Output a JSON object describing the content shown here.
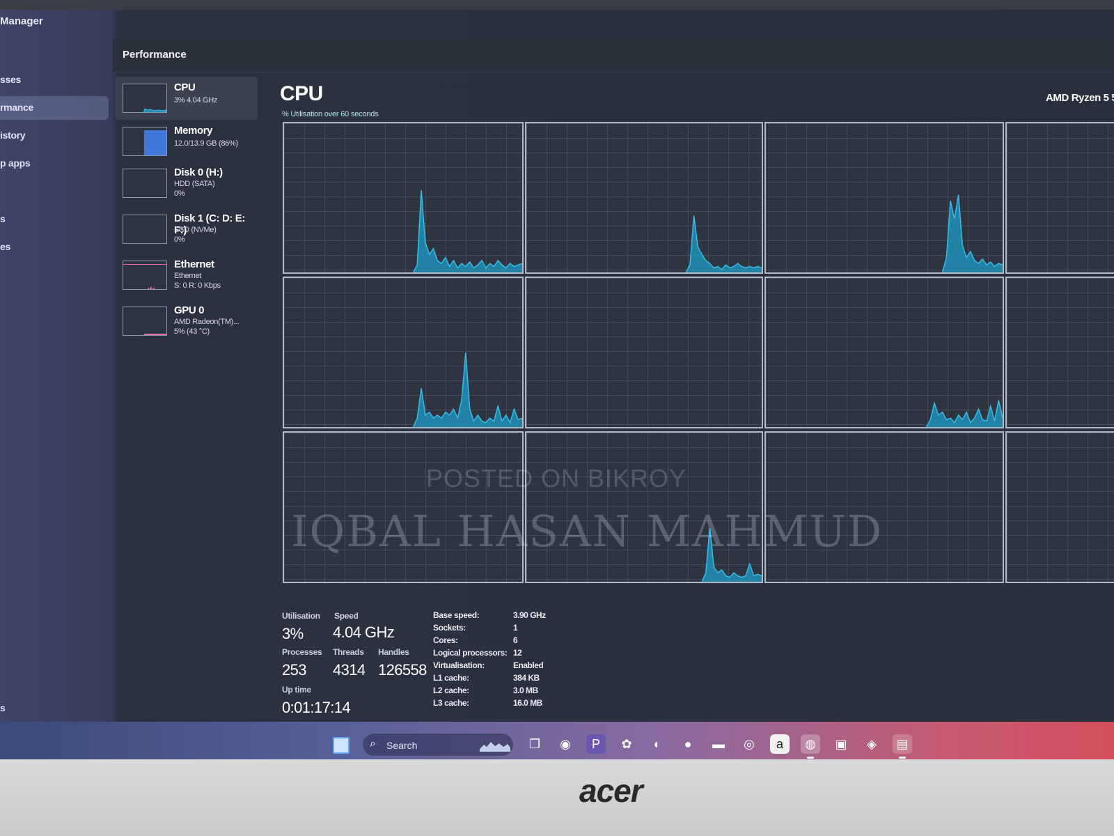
{
  "window": {
    "app_title": "Manager",
    "header_title": "Performance"
  },
  "nav": {
    "items": [
      {
        "label": "sses",
        "selected": false
      },
      {
        "label": "rmance",
        "selected": true
      },
      {
        "label": "istory",
        "selected": false
      },
      {
        "label": "p apps",
        "selected": false
      },
      {
        "label": "s",
        "selected": false
      },
      {
        "label": "es",
        "selected": false
      },
      {
        "label": "s",
        "selected": false
      }
    ],
    "footer": "clear"
  },
  "devices": [
    {
      "name": "CPU",
      "sub1": "3% 4.04 GHz",
      "sub2": "",
      "sub3": "",
      "selected": true,
      "thumb_color": "#2fb6e6",
      "usage": 0.03
    },
    {
      "name": "Memory",
      "sub1": "12.0/13.9 GB (86%)",
      "sub2": "",
      "sub3": "",
      "selected": false,
      "thumb_color": "#3f78d8",
      "usage": 0.86
    },
    {
      "name": "Disk 0 (H:)",
      "sub1": "HDD (SATA)",
      "sub2": "0%",
      "sub3": "",
      "selected": false,
      "thumb_color": "#5fc95f",
      "usage": 0
    },
    {
      "name": "Disk 1 (C: D: E: F:)",
      "sub1": "SSD (NVMe)",
      "sub2": "0%",
      "sub3": "",
      "selected": false,
      "thumb_color": "#5fc95f",
      "usage": 0
    },
    {
      "name": "Ethernet",
      "sub1": "Ethernet",
      "sub2": "S: 0 R: 0 Kbps",
      "sub3": "",
      "selected": false,
      "thumb_color": "#e86ca8",
      "usage": 0.02
    },
    {
      "name": "GPU 0",
      "sub1": "AMD Radeon(TM)...",
      "sub2": "5% (43 °C)",
      "sub3": "",
      "selected": false,
      "thumb_color": "#e86ca8",
      "usage": 0.05
    }
  ],
  "main": {
    "title": "CPU",
    "model": "AMD Ryzen 5 5",
    "graph_caption": "% Utilisation over 60 seconds",
    "line_color": "#37bde8",
    "fill_color": "#1f8fb8"
  },
  "chart_data": {
    "type": "area",
    "title": "% Utilisation over 60 seconds",
    "ylim": [
      0,
      100
    ],
    "xlim": [
      60,
      0
    ],
    "grid": true,
    "series": [
      {
        "values": [
          0,
          0,
          0,
          0,
          0,
          0,
          0,
          0,
          0,
          0,
          0,
          0,
          0,
          0,
          0,
          0,
          0,
          0,
          0,
          0,
          0,
          0,
          0,
          0,
          0,
          0,
          0,
          0,
          0,
          0,
          0,
          0,
          0,
          5,
          55,
          20,
          12,
          16,
          8,
          6,
          10,
          4,
          8,
          3,
          6,
          4,
          7,
          3,
          5,
          8,
          3,
          6,
          4,
          8,
          5,
          3,
          6,
          4,
          5,
          6
        ]
      },
      {
        "values": [
          0,
          0,
          0,
          0,
          0,
          0,
          0,
          0,
          0,
          0,
          0,
          0,
          0,
          0,
          0,
          0,
          0,
          0,
          0,
          0,
          0,
          0,
          0,
          0,
          0,
          0,
          0,
          0,
          0,
          0,
          0,
          0,
          0,
          0,
          0,
          0,
          0,
          0,
          0,
          0,
          0,
          5,
          38,
          17,
          12,
          8,
          6,
          3,
          4,
          2,
          5,
          3,
          4,
          6,
          4,
          3,
          4,
          3,
          4,
          3
        ]
      },
      {
        "values": [
          0,
          0,
          0,
          0,
          0,
          0,
          0,
          0,
          0,
          0,
          0,
          0,
          0,
          0,
          0,
          0,
          0,
          0,
          0,
          0,
          0,
          0,
          0,
          0,
          0,
          0,
          0,
          0,
          0,
          0,
          0,
          0,
          0,
          0,
          0,
          0,
          0,
          0,
          0,
          0,
          0,
          0,
          0,
          0,
          0,
          10,
          48,
          36,
          52,
          18,
          10,
          14,
          8,
          6,
          9,
          5,
          7,
          4,
          6,
          5
        ]
      },
      {
        "values": [
          0,
          0,
          0,
          0,
          0,
          0,
          0,
          0,
          0,
          0,
          0,
          0,
          0,
          0,
          0,
          0,
          0,
          0,
          0,
          0,
          0,
          0,
          0,
          0,
          0,
          0,
          0,
          0,
          0,
          0,
          0,
          0,
          0,
          0,
          0,
          0,
          0,
          0,
          0,
          0,
          0,
          0,
          0,
          0,
          0,
          0,
          0,
          0,
          0,
          0,
          0,
          0,
          0,
          0,
          0,
          0,
          0,
          0,
          0,
          0
        ]
      },
      {
        "values": [
          0,
          0,
          0,
          0,
          0,
          0,
          0,
          0,
          0,
          0,
          0,
          0,
          0,
          0,
          0,
          0,
          0,
          0,
          0,
          0,
          0,
          0,
          0,
          0,
          0,
          0,
          0,
          0,
          0,
          0,
          0,
          0,
          0,
          6,
          26,
          8,
          10,
          6,
          8,
          6,
          10,
          8,
          12,
          6,
          18,
          50,
          12,
          4,
          8,
          4,
          3,
          6,
          4,
          14,
          4,
          8,
          3,
          12,
          5,
          6
        ]
      },
      {
        "values": [
          0,
          0,
          0,
          0,
          0,
          0,
          0,
          0,
          0,
          0,
          0,
          0,
          0,
          0,
          0,
          0,
          0,
          0,
          0,
          0,
          0,
          0,
          0,
          0,
          0,
          0,
          0,
          0,
          0,
          0,
          0,
          0,
          0,
          0,
          0,
          0,
          0,
          0,
          0,
          0,
          0,
          0,
          0,
          0,
          0,
          0,
          0,
          0,
          0,
          0,
          0,
          0,
          0,
          0,
          0,
          0,
          0,
          0,
          0,
          0
        ]
      },
      {
        "values": [
          0,
          0,
          0,
          0,
          0,
          0,
          0,
          0,
          0,
          0,
          0,
          0,
          0,
          0,
          0,
          0,
          0,
          0,
          0,
          0,
          0,
          0,
          0,
          0,
          0,
          0,
          0,
          0,
          0,
          0,
          0,
          0,
          0,
          0,
          0,
          0,
          0,
          0,
          0,
          0,
          0,
          5,
          16,
          8,
          10,
          5,
          6,
          3,
          8,
          5,
          10,
          3,
          6,
          12,
          5,
          4,
          14,
          4,
          18,
          6
        ]
      },
      {
        "values": [
          0,
          0,
          0,
          0,
          0,
          0,
          0,
          0,
          0,
          0,
          0,
          0,
          0,
          0,
          0,
          0,
          0,
          0,
          0,
          0,
          0,
          0,
          0,
          0,
          0,
          0,
          0,
          0,
          0,
          0,
          0,
          0,
          0,
          0,
          0,
          0,
          0,
          0,
          0,
          0,
          0,
          0,
          0,
          0,
          0,
          0,
          0,
          0,
          0,
          0,
          0,
          0,
          0,
          0,
          0,
          0,
          0,
          0,
          0,
          0
        ]
      },
      {
        "values": [
          0,
          0,
          0,
          0,
          0,
          0,
          0,
          0,
          0,
          0,
          0,
          0,
          0,
          0,
          0,
          0,
          0,
          0,
          0,
          0,
          0,
          0,
          0,
          0,
          0,
          0,
          0,
          0,
          0,
          0,
          0,
          0,
          0,
          0,
          0,
          0,
          0,
          0,
          0,
          0,
          0,
          0,
          0,
          0,
          0,
          0,
          0,
          0,
          0,
          0,
          0,
          0,
          0,
          0,
          0,
          0,
          0,
          0,
          0,
          0
        ]
      },
      {
        "values": [
          0,
          0,
          0,
          0,
          0,
          0,
          0,
          0,
          0,
          0,
          0,
          0,
          0,
          0,
          0,
          0,
          0,
          0,
          0,
          0,
          0,
          0,
          0,
          0,
          0,
          0,
          0,
          0,
          0,
          0,
          0,
          0,
          0,
          0,
          0,
          0,
          0,
          0,
          0,
          0,
          0,
          0,
          0,
          0,
          0,
          6,
          36,
          10,
          6,
          8,
          4,
          3,
          6,
          4,
          3,
          4,
          12,
          4,
          5,
          4
        ]
      },
      {
        "values": [
          0,
          0,
          0,
          0,
          0,
          0,
          0,
          0,
          0,
          0,
          0,
          0,
          0,
          0,
          0,
          0,
          0,
          0,
          0,
          0,
          0,
          0,
          0,
          0,
          0,
          0,
          0,
          0,
          0,
          0,
          0,
          0,
          0,
          0,
          0,
          0,
          0,
          0,
          0,
          0,
          0,
          0,
          0,
          0,
          0,
          0,
          0,
          0,
          0,
          0,
          0,
          0,
          0,
          0,
          0,
          0,
          0,
          0,
          0,
          0
        ]
      },
      {
        "values": [
          0,
          0,
          0,
          0,
          0,
          0,
          0,
          0,
          0,
          0,
          0,
          0,
          0,
          0,
          0,
          0,
          0,
          0,
          0,
          0,
          0,
          0,
          0,
          0,
          0,
          0,
          0,
          0,
          0,
          0,
          0,
          0,
          0,
          0,
          0,
          0,
          0,
          0,
          0,
          0,
          0,
          0,
          0,
          0,
          0,
          0,
          0,
          0,
          0,
          0,
          0,
          0,
          0,
          0,
          0,
          0,
          0,
          0,
          0,
          0
        ]
      }
    ]
  },
  "stats": {
    "utilisation": {
      "label": "Utilisation",
      "value": "3%"
    },
    "speed": {
      "label": "Speed",
      "value": "4.04 GHz"
    },
    "processes": {
      "label": "Processes",
      "value": "253"
    },
    "threads": {
      "label": "Threads",
      "value": "4314"
    },
    "handles": {
      "label": "Handles",
      "value": "126558"
    },
    "uptime": {
      "label": "Up time",
      "value": "0:01:17:14"
    }
  },
  "specs": [
    {
      "label": "Base speed:",
      "value": "3.90 GHz"
    },
    {
      "label": "Sockets:",
      "value": "1"
    },
    {
      "label": "Cores:",
      "value": "6"
    },
    {
      "label": "Logical processors:",
      "value": "12"
    },
    {
      "label": "Virtualisation:",
      "value": "Enabled"
    },
    {
      "label": "L1 cache:",
      "value": "384 KB"
    },
    {
      "label": "L2 cache:",
      "value": "3.0 MB"
    },
    {
      "label": "L3 cache:",
      "value": "16.0 MB"
    }
  ],
  "watermarks": {
    "line1": "POSTED ON BIKROY",
    "line2": "IQBAL HASAN MAHMUD"
  },
  "taskbar": {
    "search_label": "Search",
    "icons": [
      {
        "name": "task-view-icon",
        "glyph": "❐",
        "bg": "transparent"
      },
      {
        "name": "chrome-icon",
        "glyph": "◉",
        "bg": "transparent"
      },
      {
        "name": "pinned-app-p-icon",
        "glyph": "P",
        "bg": "#6a56b0"
      },
      {
        "name": "colorful-app-icon",
        "glyph": "✿",
        "bg": "transparent"
      },
      {
        "name": "edge-icon",
        "glyph": "◐",
        "bg": "transparent"
      },
      {
        "name": "white-circle-app-icon",
        "glyph": "●",
        "bg": "transparent"
      },
      {
        "name": "file-explorer-icon",
        "glyph": "▬",
        "bg": "transparent"
      },
      {
        "name": "red-circle-app-icon",
        "glyph": "◎",
        "bg": "transparent"
      },
      {
        "name": "amazon-icon",
        "glyph": "a",
        "bg": "#f2f2f2"
      },
      {
        "name": "active-app-icon",
        "glyph": "◍",
        "bg": "rgba(255,255,255,0.25)"
      },
      {
        "name": "store-icon",
        "glyph": "▣",
        "bg": "transparent"
      },
      {
        "name": "copilot-icon",
        "glyph": "◈",
        "bg": "transparent"
      },
      {
        "name": "task-manager-icon",
        "glyph": "▤",
        "bg": "rgba(255,255,255,0.2)"
      }
    ]
  },
  "monitor": {
    "brand": "acer"
  }
}
